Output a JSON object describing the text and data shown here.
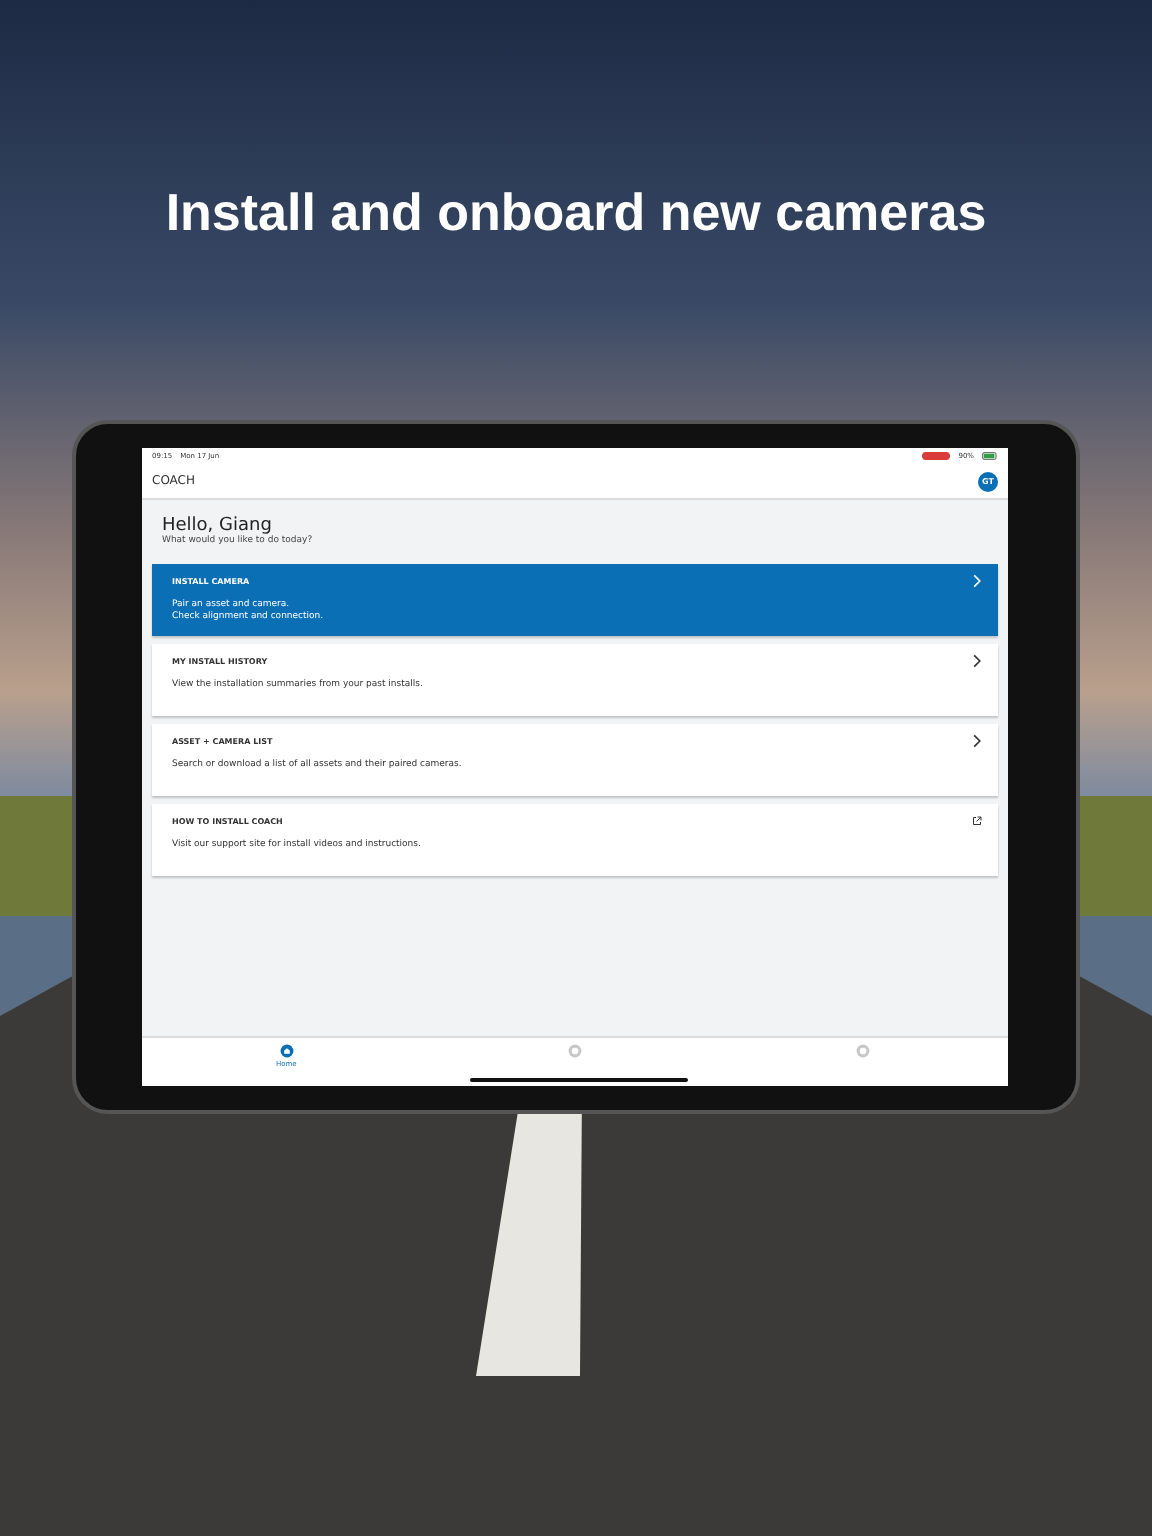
{
  "headline": "Install and onboard new cameras",
  "status_bar": {
    "time": "09:15",
    "date": "Mon 17 Jun",
    "battery": "90%"
  },
  "app": {
    "logo": "COACH",
    "avatar": "GT"
  },
  "greeting": {
    "title": "Hello, Giang",
    "subtitle": "What would you like to do today?"
  },
  "cards": [
    {
      "title": "INSTALL CAMERA",
      "lines": [
        "Pair an asset and camera.",
        "Check alignment and connection."
      ],
      "selected": true,
      "kind": "chevron"
    },
    {
      "title": "MY INSTALL HISTORY",
      "lines": [
        "View the installation summaries from your past installs."
      ],
      "selected": false,
      "kind": "chevron"
    },
    {
      "title": "ASSET + CAMERA LIST",
      "lines": [
        "Search or download a list of all assets and their paired cameras."
      ],
      "selected": false,
      "kind": "chevron"
    },
    {
      "title": "HOW TO INSTALL COACH",
      "lines": [
        "Visit our support site for install videos and instructions."
      ],
      "selected": false,
      "kind": "external"
    }
  ],
  "tabs": [
    {
      "label": "Home",
      "selected": true,
      "kind": "home"
    },
    {
      "selected": false,
      "kind": "circle"
    },
    {
      "selected": false,
      "kind": "circle"
    }
  ]
}
